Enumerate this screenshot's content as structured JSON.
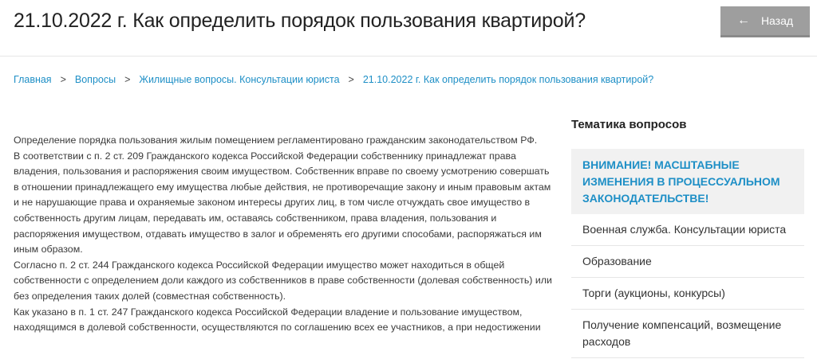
{
  "header": {
    "title": "21.10.2022 г. Как определить порядок пользования квартирой?",
    "back_label": "Назад",
    "back_icon": "arrow-left-icon"
  },
  "breadcrumb": [
    "Главная",
    "Вопросы",
    "Жилищные вопросы. Консультации юриста",
    "21.10.2022 г. Как определить порядок пользования квартирой?"
  ],
  "breadcrumb_separator": ">",
  "article": {
    "paragraphs": [
      "Определение порядка пользования жилым помещением регламентировано гражданским законодательством РФ.",
      "В соответствии с п. 2 ст. 209 Гражданского кодекса Российской Федерации собственнику принадлежат права владения, пользования и распоряжения своим имуществом. Собственник вправе по своему усмотрению совершать в отношении принадлежащего ему имущества любые действия, не противоречащие закону и иным правовым актам и не нарушающие права и охраняемые законом интересы других лиц, в том числе отчуждать свое имущество в собственность другим лицам, передавать им, оставаясь собственником, права владения, пользования и распоряжения имуществом, отдавать имущество в залог и обременять его другими способами, распоряжаться им иным образом.",
      "Согласно п. 2 ст. 244 Гражданского кодекса Российской Федерации имущество может находиться в общей собственности с определением доли каждого из собственников в праве собственности (долевая собственность) или без определения таких долей (совместная собственность).",
      "Как указано в п. 1 ст. 247 Гражданского кодекса Российской Федерации владение и пользование имуществом, находящимся в долевой собственности, осуществляются по соглашению всех ее участников, а при недостижении"
    ]
  },
  "sidebar": {
    "title": "Тематика вопросов",
    "featured": "ВНИМАНИЕ! МАСШТАБНЫЕ ИЗМЕНЕНИЯ В ПРОЦЕССУАЛЬНОМ ЗАКОНОДАТЕЛЬСТВЕ!",
    "items": [
      "Военная служба. Консультации юриста",
      "Образование",
      "Торги (аукционы, конкурсы)",
      "Получение компенсаций, возмещение расходов"
    ]
  },
  "colors": {
    "link": "#1e8fc6",
    "back_button_bg": "#9e9e9e",
    "featured_bg": "#f1f1f1"
  }
}
